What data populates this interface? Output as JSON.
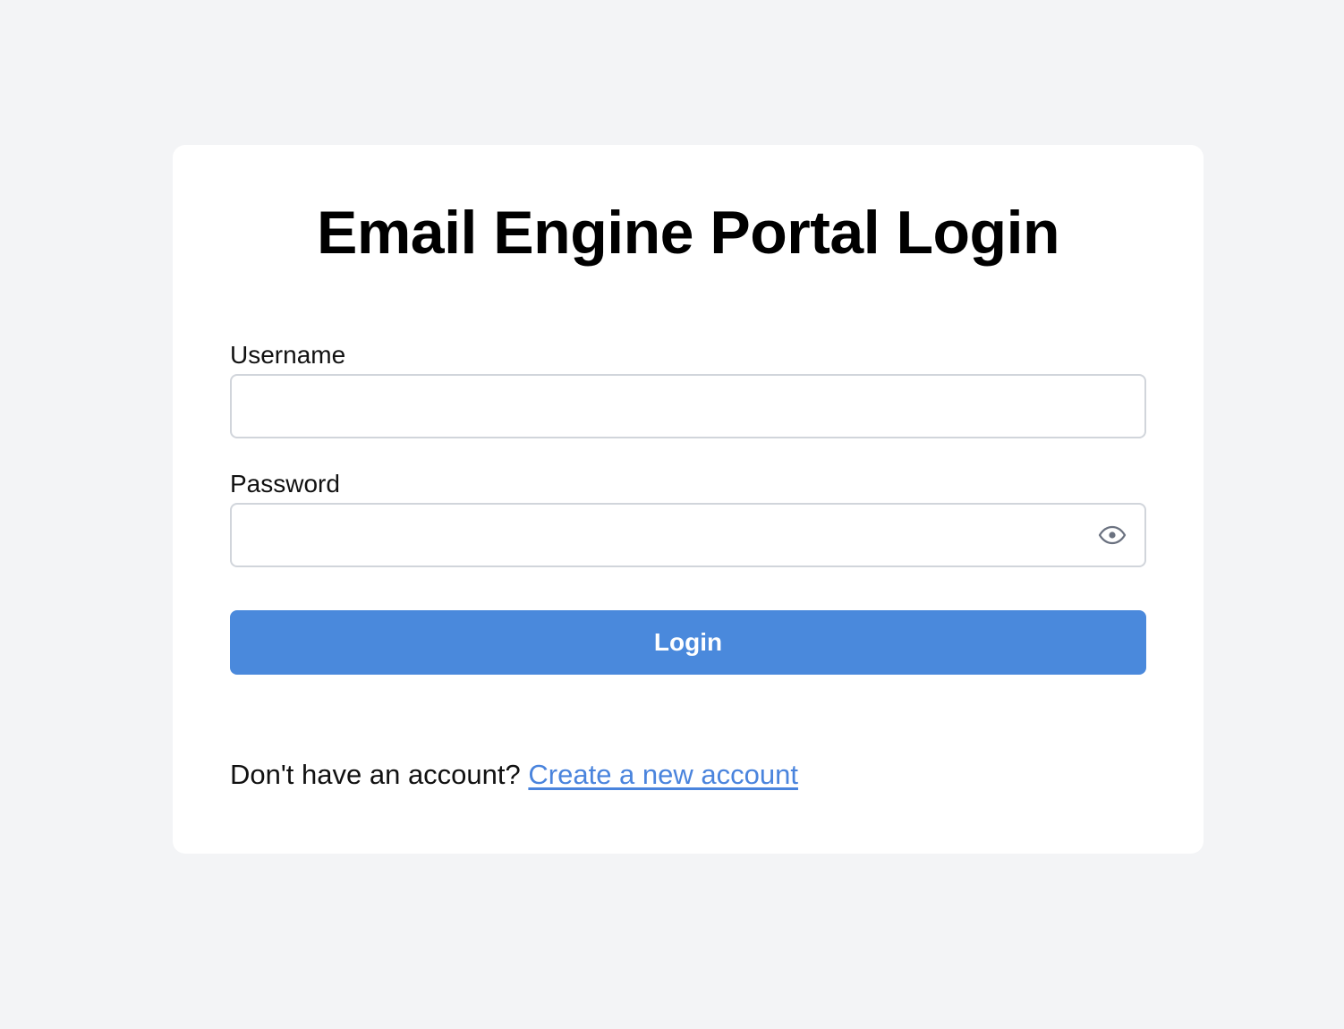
{
  "page": {
    "title": "Email Engine Portal Login"
  },
  "form": {
    "username": {
      "label": "Username",
      "value": "",
      "placeholder": ""
    },
    "password": {
      "label": "Password",
      "value": "",
      "placeholder": ""
    },
    "submit_label": "Login"
  },
  "footer": {
    "prompt": "Don't have an account?",
    "link_label": "Create a new account"
  },
  "icons": {
    "password_toggle": "eye-icon"
  },
  "colors": {
    "background": "#f3f4f6",
    "card": "#ffffff",
    "button": "#4a89dc",
    "link": "#4a84dd",
    "input_border": "#d1d5db",
    "icon": "#6b7280"
  }
}
